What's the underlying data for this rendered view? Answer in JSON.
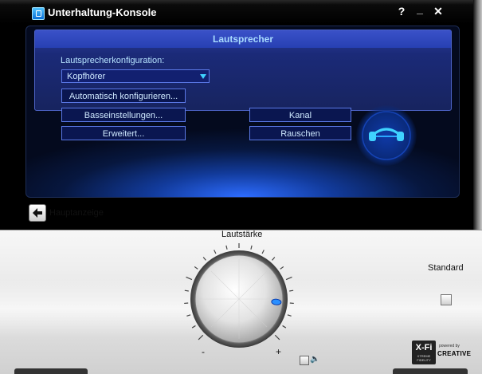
{
  "window": {
    "title": "Unterhaltung-Konsole",
    "help_label": "?",
    "minimize_label": "_",
    "close_label": "✕"
  },
  "panel": {
    "title": "Lautsprecher",
    "config_label": "Lautsprecherkonfiguration:",
    "config_value": "Kopfhörer",
    "auto_config_label": "Automatisch konfigurieren...",
    "bass_label": "Basseinstellungen...",
    "advanced_label": "Erweitert...",
    "channel_label": "Kanal",
    "noise_label": "Rauschen"
  },
  "nav": {
    "back_label": "Hauptanzeige"
  },
  "volume": {
    "label": "Lautstärke",
    "min_label": "-",
    "max_label": "+",
    "level": 0.85
  },
  "standard": {
    "label": "Standard"
  },
  "branding": {
    "xfi": "X-Fi",
    "xfi_sub": "XTREME FIDELITY",
    "powered": "powered by",
    "creative": "CREATIVE"
  },
  "colors": {
    "accent": "#3fd3ff",
    "panel_title": "#a8dbff"
  }
}
